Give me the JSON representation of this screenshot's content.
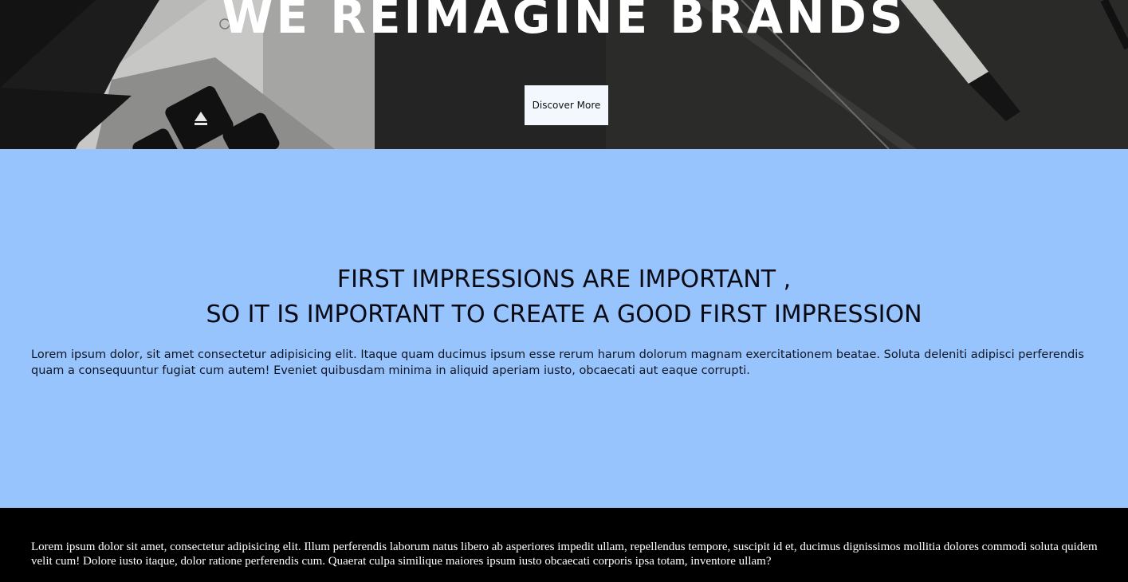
{
  "hero": {
    "title": "WE REIMAGINE BRANDS",
    "button_label": "Discover More"
  },
  "impressions": {
    "heading_line1": "FIRST IMPRESSIONS ARE IMPORTANT ,",
    "heading_line2": "SO IT IS IMPORTANT TO CREATE A GOOD FIRST IMPRESSION",
    "body": "Lorem ipsum dolor, sit amet consectetur adipisicing elit. Itaque quam ducimus ipsum esse rerum harum dolorum magnam exercitationem beatae. Soluta deleniti adipisci perferendis quam a consequuntur fugiat cum autem! Eveniet quibusdam minima in aliquid aperiam iusto, obcaecati aut eaque corrupti.",
    "background_color": "#98c4fd"
  },
  "footer": {
    "text": "Lorem ipsum dolor sit amet, consectetur adipisicing elit. Illum perferendis laborum natus libero ab asperiores impedit ullam, repellendus tempore, suscipit id et, ducimus dignissimos mollitia dolores commodi soluta quidem velit cum! Dolore iusto itaque, dolor ratione perferendis cum. Quaerat culpa similique maiores ipsum iusto obcaecati corporis ipsa totam, inventore ullam?",
    "background_color": "#000000"
  }
}
